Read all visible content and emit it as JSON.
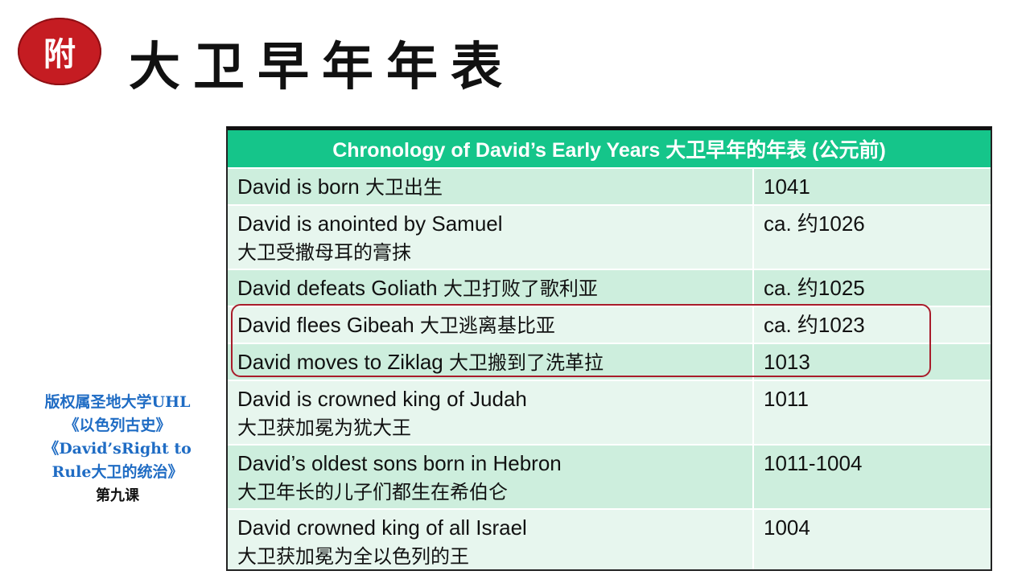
{
  "badge": {
    "char": "附"
  },
  "page_title": "大卫早年年表",
  "sidebar": {
    "line1": "版权属圣地大学UHL",
    "line2": "《以色列古史》",
    "line3": "《David’sRight to",
    "line4": "Rule大卫的统治》",
    "line5": "第九课"
  },
  "table": {
    "header": "Chronology of David’s Early Years 大卫早年的年表 (公元前)",
    "rows": [
      {
        "event_en": "David is born",
        "event_zh": "大卫出生",
        "year": "1041"
      },
      {
        "event_en": "David is anointed by Samuel",
        "event_zh": "大卫受撒母耳的膏抹",
        "year": "ca. 约1026"
      },
      {
        "event_en": "David defeats Goliath",
        "event_zh": "大卫打败了歌利亚",
        "year": "ca. 约1025"
      },
      {
        "event_en": "David flees Gibeah",
        "event_zh": "大卫逃离基比亚",
        "year": "ca. 约1023"
      },
      {
        "event_en": "David moves to Ziklag",
        "event_zh": "大卫搬到了洗革拉",
        "year": "1013"
      },
      {
        "event_en": "David is crowned king of Judah",
        "event_zh": "大卫获加冕为犹大王",
        "year": "1011"
      },
      {
        "event_en": "David’s oldest sons born in Hebron",
        "event_zh": "大卫年长的儿子们都生在希伯仑",
        "year": "1011-1004"
      },
      {
        "event_en": "David crowned king of all Israel",
        "event_zh": "大卫获加冕为全以色列的王",
        "year": "1004"
      }
    ]
  }
}
